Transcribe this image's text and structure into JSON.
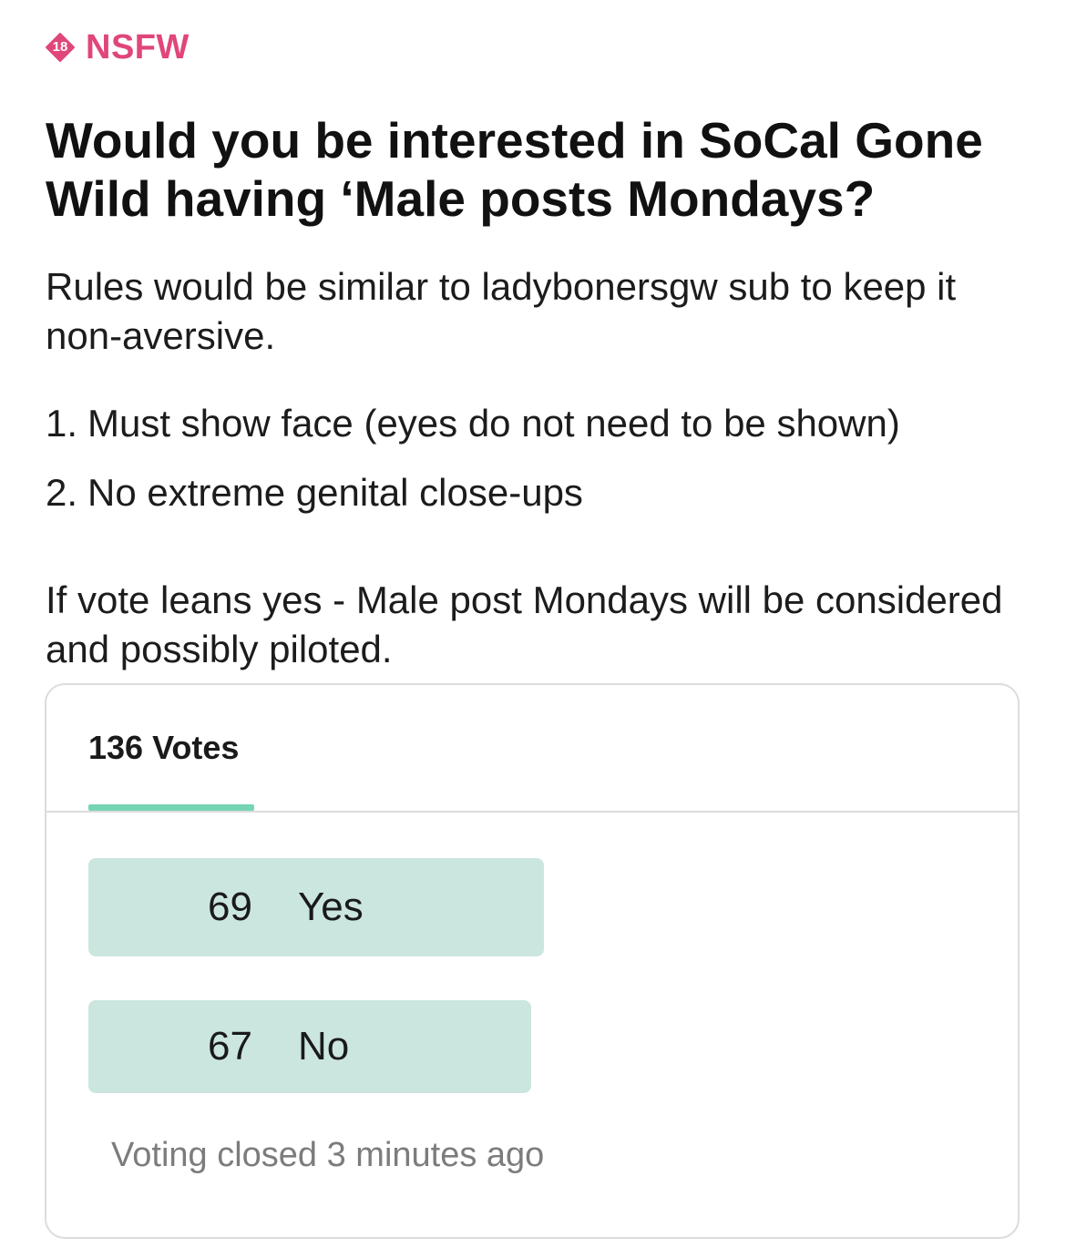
{
  "post": {
    "nsfw_badge_number": "18",
    "nsfw_label": "NSFW",
    "title": "Would you be interested in SoCal Gone Wild having ‘Male posts Mondays?",
    "intro": "Rules would be similar to ladybonersgw sub to keep it non-aversive.",
    "rules": [
      {
        "number": "1.",
        "text": "Must show face (eyes do not need to be shown)"
      },
      {
        "number": "2.",
        "text": "No extreme genital close-ups"
      }
    ],
    "outcome": "If vote leans yes - Male post Mondays will be considered and possibly piloted."
  },
  "poll": {
    "vote_count_label": "136 Votes",
    "options": [
      {
        "count": "69",
        "label": "Yes",
        "fraction": 0.507
      },
      {
        "count": "67",
        "label": "No",
        "fraction": 0.493
      }
    ],
    "status": "Voting closed 3 minutes ago"
  },
  "colors": {
    "nsfw_accent": "#e0467a",
    "tab_underline": "#74d4b5",
    "result_bar": "#cbe6df",
    "muted_text": "#7c7c7c",
    "border": "#dcdcdc"
  },
  "icons": {
    "nsfw_badge": "eighteen-plus-badge-icon"
  }
}
